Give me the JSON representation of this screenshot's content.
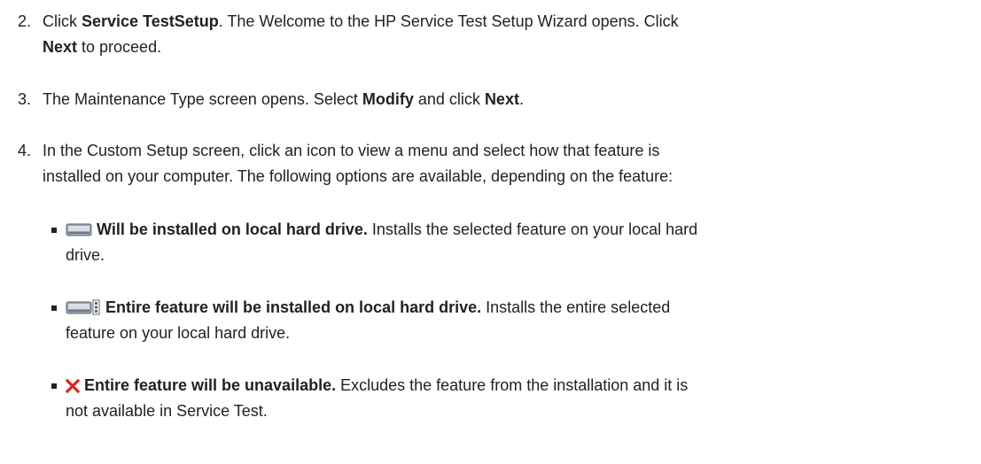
{
  "steps": [
    {
      "number": "2.",
      "bold_1": "Service TestSetup",
      "text_1": ". The Welcome to the HP Service Test Setup Wizard opens. Click",
      "prefix": "Click ",
      "bold_2": "Next",
      "text_2": " to proceed."
    },
    {
      "number": "3.",
      "text_1": "The Maintenance Type screen opens. Select ",
      "bold_1": "Modify",
      "text_2": " and click ",
      "bold_2": "Next",
      "text_3": "."
    },
    {
      "number": "4.",
      "line_1": "In the Custom Setup screen, click an icon to view a menu and select how that feature is",
      "line_2": "installed on your computer. The following options are available, depending on the feature:"
    }
  ],
  "options": [
    {
      "icon": "hard-drive-icon",
      "bold": "Will be installed on local hard drive.",
      "line_1": " Installs the selected feature on your local hard",
      "line_2": "drive."
    },
    {
      "icon": "hard-drive-entire-icon",
      "bold": "Entire feature will be installed on local hard drive.",
      "line_1": " Installs the entire selected",
      "line_2": "feature on your local hard drive."
    },
    {
      "icon": "red-x-icon",
      "bold": "Entire feature will be unavailable.",
      "line_1": " Excludes the feature from the installation and it is",
      "line_2": "not available in Service Test."
    }
  ],
  "colors": {
    "text": "#222222",
    "x_icon": "#d42a1c",
    "drive_icon": "#8a94a6"
  }
}
